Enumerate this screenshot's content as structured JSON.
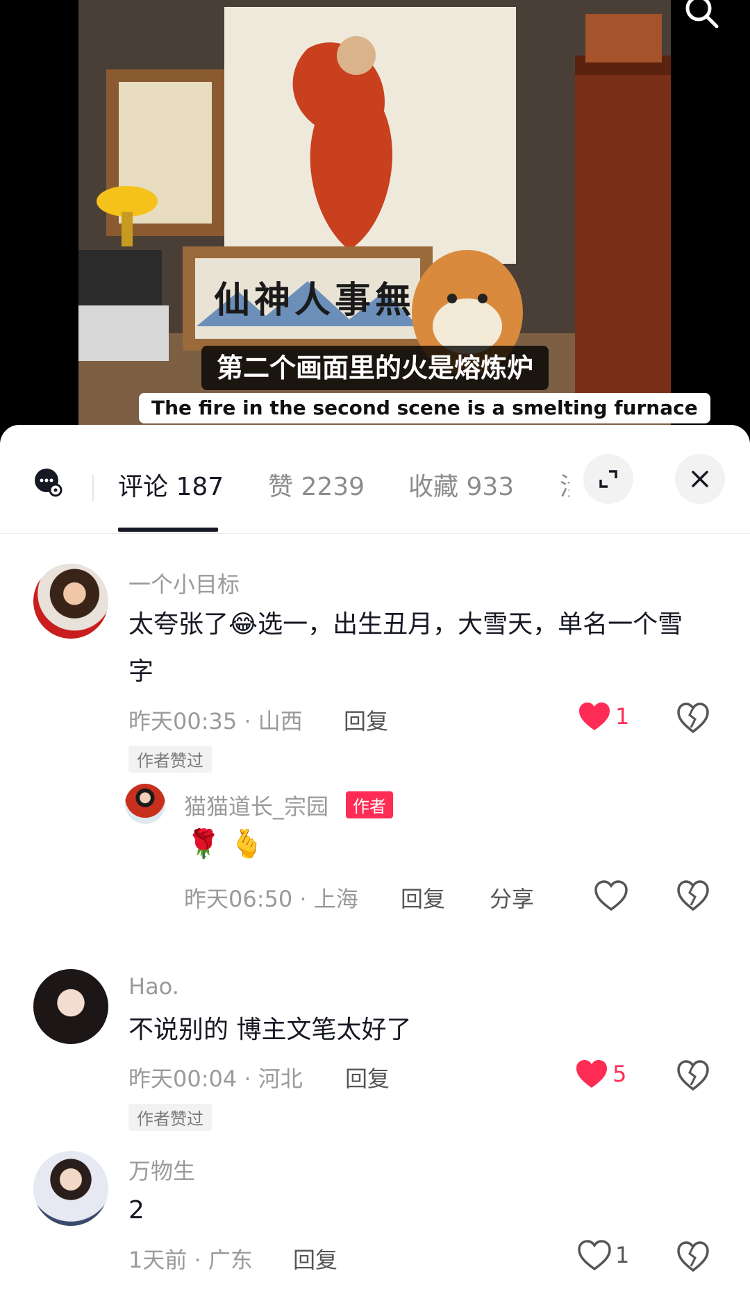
{
  "video": {
    "subtitle_cn": "第二个画面里的火是熔炼炉",
    "subtitle_en": "The fire in the second scene is a smelting furnace",
    "painting_calligraphy": "仙神人事無",
    "search_icon": "search-icon"
  },
  "tabs": [
    {
      "label": "评论 187"
    },
    {
      "label": "赞 2239"
    },
    {
      "label": "收藏 933"
    },
    {
      "label": "涉"
    }
  ],
  "icons": {
    "chat": "chat-settings-icon",
    "expand": "expand-icon",
    "close": "close-icon",
    "heart": "heart-icon",
    "dislike": "broken-heart-icon"
  },
  "colors": {
    "accent": "#fe2c55",
    "text": "#161823",
    "muted": "#9a9a9a"
  },
  "comments": [
    {
      "username": "一个小目标",
      "text_a": "太夸张了",
      "emoji": "😂",
      "text_b": "选一，出生丑月，大雪天，单名一个雪字",
      "meta": "昨天00:35 · 山西",
      "reply_label": "回复",
      "likes": "1",
      "liked": true,
      "badge": "作者赞过"
    },
    {
      "username": "Hao.",
      "text": "不说别的 博主文笔太好了",
      "meta": "昨天00:04 · 河北",
      "reply_label": "回复",
      "likes": "5",
      "liked": true,
      "badge": "作者赞过"
    },
    {
      "username": "万物生",
      "text": "2",
      "meta": "1天前 · 广东",
      "reply_label": "回复",
      "likes": "1",
      "liked": false
    }
  ],
  "reply": {
    "username": "猫猫道长_宗园",
    "author_tag": "作者",
    "emojis": "🌹 🫰",
    "meta": "昨天06:50 · 上海",
    "reply_label": "回复",
    "share_label": "分享"
  }
}
